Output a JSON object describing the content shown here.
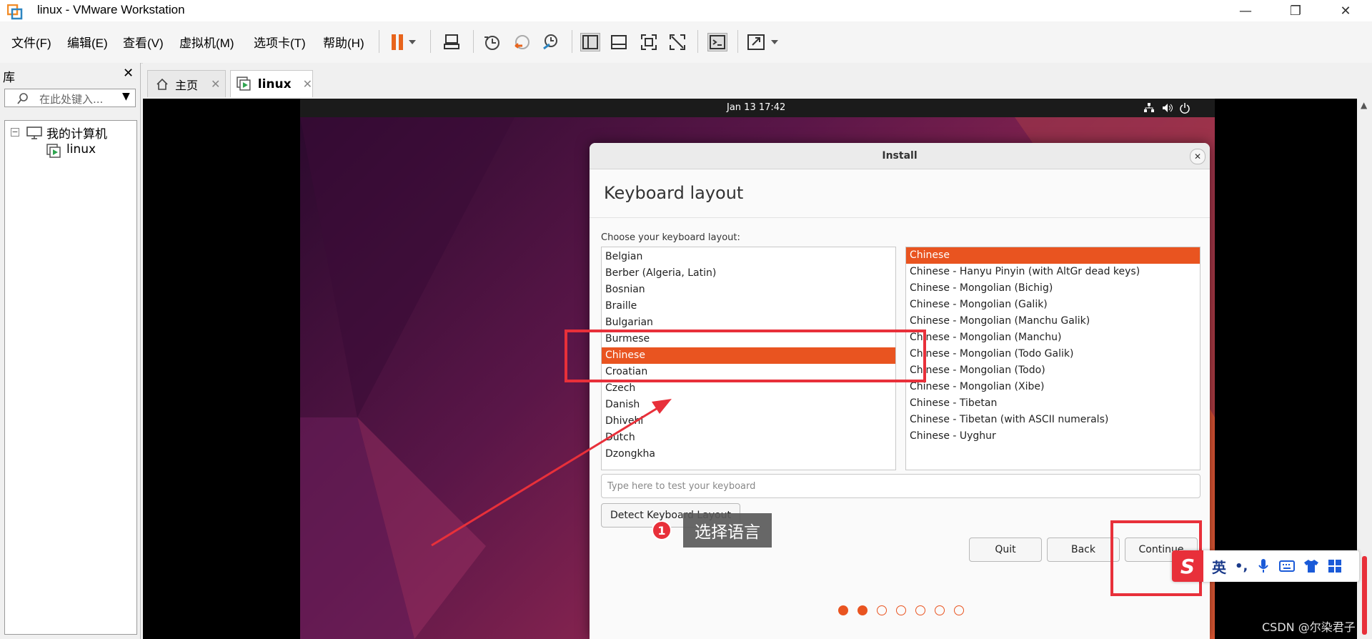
{
  "window": {
    "title": "linux - VMware Workstation"
  },
  "menu": [
    {
      "label": "文件(F)"
    },
    {
      "label": "编辑(E)"
    },
    {
      "label": "查看(V)"
    },
    {
      "label": "虚拟机(M)"
    },
    {
      "label": "选项卡(T)"
    },
    {
      "label": "帮助(H)"
    }
  ],
  "library": {
    "title": "库",
    "search_placeholder": "在此处键入...",
    "tree": [
      {
        "label": "我的计算机"
      },
      {
        "label": "linux"
      }
    ]
  },
  "tabs": [
    {
      "label": "主页"
    },
    {
      "label": "linux"
    }
  ],
  "guest": {
    "clock": "Jan 13  17:42",
    "dialog": {
      "title": "Install",
      "page_title": "Keyboard layout",
      "choose_label": "Choose your keyboard layout:",
      "layouts": [
        "Belgian",
        "Berber (Algeria, Latin)",
        "Bosnian",
        "Braille",
        "Bulgarian",
        "Burmese",
        "Chinese",
        "Croatian",
        "Czech",
        "Danish",
        "Dhivehi",
        "Dutch",
        "Dzongkha"
      ],
      "selected_layout": "Chinese",
      "variants": [
        "Chinese",
        "Chinese - Hanyu Pinyin (with AltGr dead keys)",
        "Chinese - Mongolian (Bichig)",
        "Chinese - Mongolian (Galik)",
        "Chinese - Mongolian (Manchu Galik)",
        "Chinese - Mongolian (Manchu)",
        "Chinese - Mongolian (Todo Galik)",
        "Chinese - Mongolian (Todo)",
        "Chinese - Mongolian (Xibe)",
        "Chinese - Tibetan",
        "Chinese - Tibetan (with ASCII numerals)",
        "Chinese - Uyghur"
      ],
      "selected_variant": "Chinese",
      "test_placeholder": "Type here to test your keyboard",
      "detect_button": "Detect Keyboard Layout",
      "quit_button": "Quit",
      "back_button": "Back",
      "continue_button": "Continue",
      "progress_step": 2,
      "progress_total": 7
    }
  },
  "annotation": {
    "step": "1",
    "text": "选择语言"
  },
  "ime": {
    "lang": "英",
    "punct": "•,"
  },
  "watermark": "CSDN @尔染君子",
  "colors": {
    "accent": "#e95420",
    "annotation_red": "#e8303a"
  }
}
